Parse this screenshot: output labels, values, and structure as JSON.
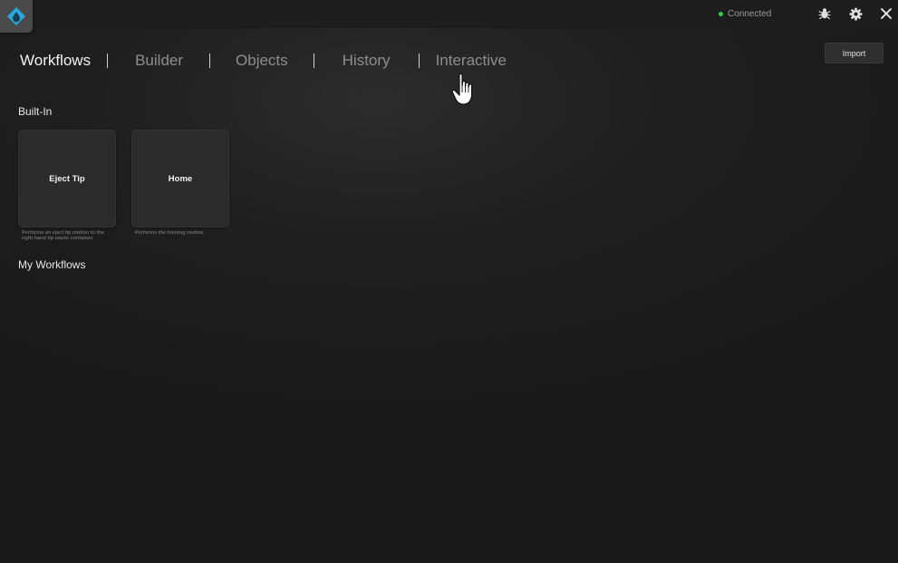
{
  "topbar": {
    "status_label": "Connected",
    "status_color": "#2bd13c",
    "logo_icon": "droplet-logo-icon",
    "icons": [
      "bug-icon",
      "gear-icon",
      "close-icon"
    ]
  },
  "nav": {
    "tabs": [
      {
        "label": "Workflows",
        "active": true
      },
      {
        "label": "Builder",
        "active": false
      },
      {
        "label": "Objects",
        "active": false
      },
      {
        "label": "History",
        "active": false
      },
      {
        "label": "Interactive",
        "active": false
      }
    ]
  },
  "import_label": "Import",
  "sections": {
    "builtin_title": "Built-In",
    "my_title": "My Workflows"
  },
  "builtin": [
    {
      "name": "Eject Tip",
      "description": "Performs an eject tip motion to the right hand tip waste container."
    },
    {
      "name": "Home",
      "description": "Performs the homing routine."
    }
  ],
  "colors": {
    "accent": "#2aa7e0",
    "background": "#1f1f1f",
    "card": "#2b2b2b"
  }
}
